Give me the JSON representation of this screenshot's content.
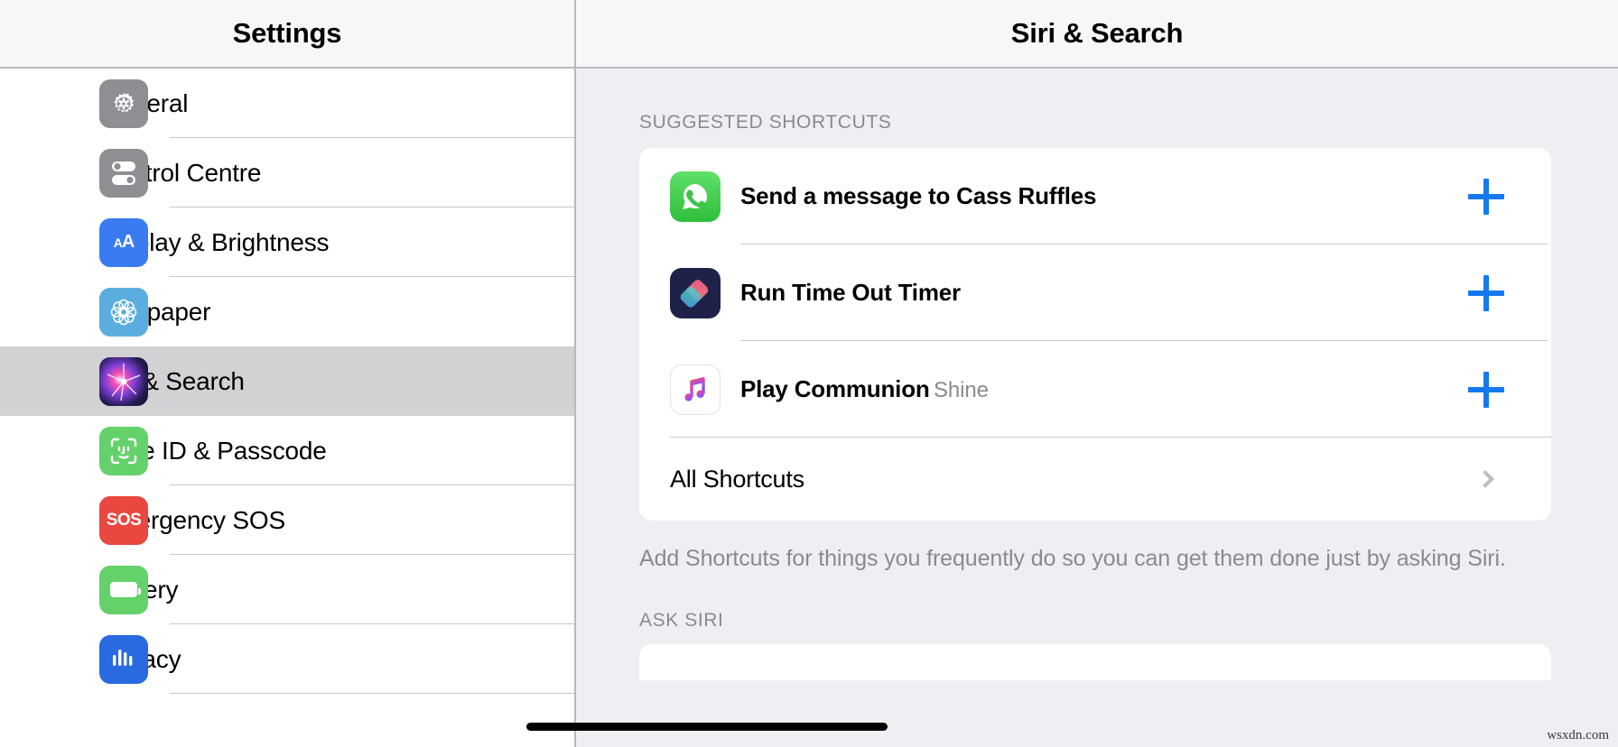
{
  "sidebar": {
    "title": "Settings",
    "items": [
      {
        "label": "General",
        "icon": "gear-icon",
        "selected": false
      },
      {
        "label": "Control Centre",
        "icon": "control-centre-icon",
        "selected": false
      },
      {
        "label": "Display & Brightness",
        "icon": "display-brightness-icon",
        "selected": false
      },
      {
        "label": "Wallpaper",
        "icon": "wallpaper-icon",
        "selected": false
      },
      {
        "label": "Siri & Search",
        "icon": "siri-icon",
        "selected": true
      },
      {
        "label": "Face ID & Passcode",
        "icon": "face-id-icon",
        "selected": false
      },
      {
        "label": "Emergency SOS",
        "icon": "sos-icon",
        "selected": false
      },
      {
        "label": "Battery",
        "icon": "battery-icon",
        "selected": false
      },
      {
        "label": "Privacy",
        "icon": "privacy-icon",
        "selected": false
      }
    ]
  },
  "detail": {
    "title": "Siri & Search",
    "suggested_section_header": "SUGGESTED SHORTCUTS",
    "shortcuts": [
      {
        "title": "Send a message to Cass Ruffles",
        "subtitle": "",
        "icon": "whatsapp-icon",
        "action": "add-shortcut-plus-icon"
      },
      {
        "title": "Run Time Out Timer",
        "subtitle": "",
        "icon": "shortcuts-icon",
        "action": "add-shortcut-plus-icon"
      },
      {
        "title": "Play Communion",
        "subtitle": "Shine",
        "icon": "music-icon",
        "action": "add-shortcut-plus-icon"
      }
    ],
    "all_shortcuts_label": "All Shortcuts",
    "footer_note": "Add Shortcuts for things you frequently do so you can get them done just by asking Siri.",
    "ask_siri_header": "ASK SIRI"
  },
  "watermark": "wsxdn.com",
  "colors": {
    "accent_blue": "#1479ef",
    "panel_background": "#efeef3",
    "card_background": "#ffffff",
    "selected_row": "#d2d2d4",
    "secondary_text": "#8a8a8f"
  }
}
